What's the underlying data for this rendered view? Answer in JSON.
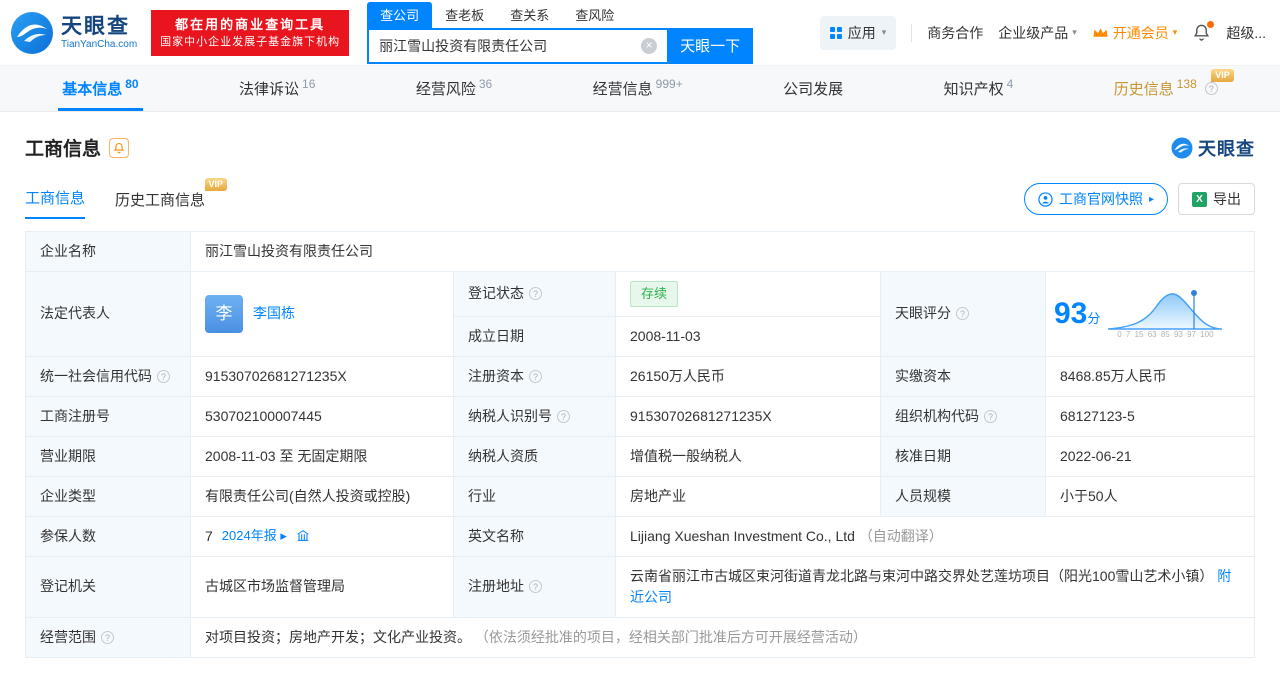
{
  "vip_label": "VIP",
  "colors": {
    "accent": "#0084ff",
    "promo_red": "#e8141e",
    "member_orange": "#ff8a00",
    "status_green": "#2bb24c",
    "vip_gold": "#e7a83e",
    "history_gold": "#c8952f"
  },
  "header": {
    "logo_title": "天眼查",
    "logo_domain": "TianYanCha.com",
    "promo_line1": "都在用的商业查询工具",
    "promo_line2": "国家中小企业发展子基金旗下机构",
    "search_tabs": [
      {
        "label": "查公司",
        "active": true
      },
      {
        "label": "查老板",
        "active": false
      },
      {
        "label": "查关系",
        "active": false
      },
      {
        "label": "查风险",
        "active": false
      }
    ],
    "search_value": "丽江雪山投资有限责任公司",
    "search_button": "天眼一下",
    "apps_label": "应用",
    "biz_coop": "商务合作",
    "enterprise_product": "企业级产品",
    "open_member": "开通会员",
    "super_label": "超级..."
  },
  "nav_tabs": [
    {
      "label": "基本信息",
      "count": "80",
      "active": true
    },
    {
      "label": "法律诉讼",
      "count": "16"
    },
    {
      "label": "经营风险",
      "count": "36"
    },
    {
      "label": "经营信息",
      "count": "999+"
    },
    {
      "label": "公司发展",
      "count": ""
    },
    {
      "label": "知识产权",
      "count": "4"
    },
    {
      "label": "历史信息",
      "count": "138",
      "vip": true
    }
  ],
  "section": {
    "title": "工商信息",
    "brand_watermark": "天眼查",
    "tab_current": "工商信息",
    "tab_history": "历史工商信息",
    "snapshot_button": "工商官网快照",
    "export_button": "导出"
  },
  "info": {
    "company_name_label": "企业名称",
    "company_name": "丽江雪山投资有限责任公司",
    "legal_rep_label": "法定代表人",
    "legal_rep_avatar": "李",
    "legal_rep_name": "李国栋",
    "reg_status_label": "登记状态",
    "reg_status": "存续",
    "establish_label": "成立日期",
    "establish_date": "2008-11-03",
    "score_label": "天眼评分",
    "score_value": "93",
    "score_unit": "分",
    "score_axis": "0 7 15 63 85 93 97 100",
    "credit_code_label": "统一社会信用代码",
    "credit_code": "91530702681271235X",
    "reg_capital_label": "注册资本",
    "reg_capital": "26150万人民币",
    "paid_capital_label": "实缴资本",
    "paid_capital": "8468.85万人民币",
    "reg_number_label": "工商注册号",
    "reg_number": "530702100007445",
    "taxpayer_id_label": "纳税人识别号",
    "taxpayer_id": "91530702681271235X",
    "org_code_label": "组织机构代码",
    "org_code": "68127123-5",
    "business_term_label": "营业期限",
    "business_term": "2008-11-03 至 无固定期限",
    "taxpayer_quality_label": "纳税人资质",
    "taxpayer_quality": "增值税一般纳税人",
    "approval_date_label": "核准日期",
    "approval_date": "2022-06-21",
    "company_type_label": "企业类型",
    "company_type": "有限责任公司(自然人投资或控股)",
    "industry_label": "行业",
    "industry": "房地产业",
    "staff_size_label": "人员规模",
    "staff_size": "小于50人",
    "insured_label": "参保人数",
    "insured_count": "7",
    "insured_report": "2024年报",
    "insured_report_arrow": "▸",
    "english_name_label": "英文名称",
    "english_name": "Lijiang Xueshan Investment Co., Ltd",
    "english_name_note": "（自动翻译）",
    "reg_authority_label": "登记机关",
    "reg_authority": "古城区市场监督管理局",
    "address_label": "注册地址",
    "address": "云南省丽江市古城区束河街道青龙北路与束河中路交界处艺莲坊项目（阳光100雪山艺术小镇）",
    "address_link": "附近公司",
    "business_scope_label": "经营范围",
    "business_scope_main": "对项目投资；房地产开发；文化产业投资。",
    "business_scope_note": "（依法须经批准的项目，经相关部门批准后方可开展经营活动）"
  }
}
